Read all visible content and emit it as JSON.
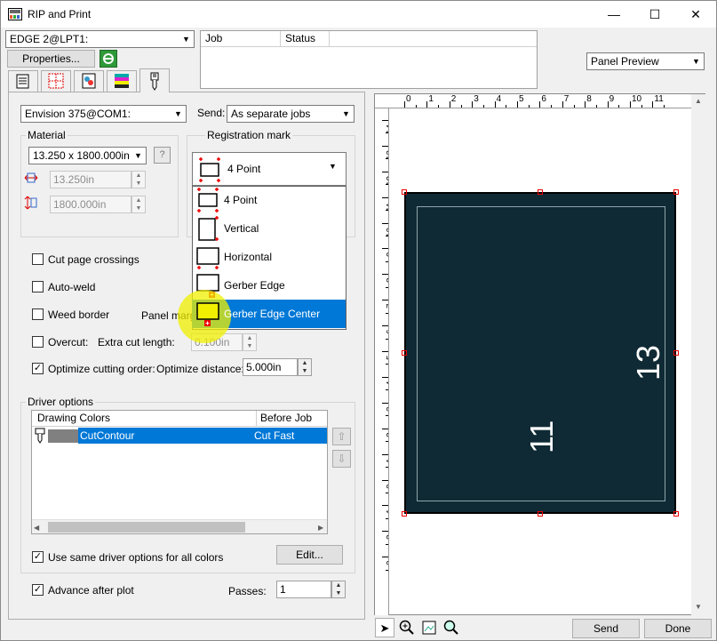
{
  "window": {
    "title": "RIP and Print",
    "minimize": "—",
    "maximize": "☐",
    "close": "✕"
  },
  "top": {
    "printer": "EDGE 2@LPT1:",
    "properties_label": "Properties...",
    "job_columns": [
      "Job",
      "Status"
    ],
    "preview_mode": "Panel Preview"
  },
  "cutter": {
    "device": "Envision 375@COM1:",
    "send_label": "Send:",
    "send_mode": "As separate jobs"
  },
  "material": {
    "title": "Material",
    "size": "13.250 x 1800.000in",
    "width": "13.250in",
    "length": "1800.000in"
  },
  "registration": {
    "title": "Registration mark",
    "selected": "4 Point",
    "options": [
      "4 Point",
      "Vertical",
      "Horizontal",
      "Gerber Edge",
      "Gerber Edge Center"
    ],
    "highlighted_index": 4
  },
  "options": {
    "cut_page_crossings": "Cut page crossings",
    "auto_weld": "Auto-weld",
    "weed_border": "Weed border",
    "panel_margin": "Panel margi",
    "overcut": "Overcut:",
    "extra_cut_length": "Extra cut length:",
    "extra_cut_value": "0.100in",
    "optimize_cutting_order": "Optimize cutting order:",
    "optimize_distance_label": "Optimize distance:",
    "optimize_distance_value": "5.000in"
  },
  "driver": {
    "title": "Driver options",
    "columns": [
      "Drawing Colors",
      "Before Job"
    ],
    "row": {
      "color_name": "CutContour",
      "action": "Cut Fast"
    },
    "same_options": "Use same driver options for all colors",
    "edit_label": "Edit..."
  },
  "bottom": {
    "advance_after_plot": "Advance after plot",
    "passes_label": "Passes:",
    "passes_value": "1",
    "send_label": "Send",
    "done_label": "Done"
  },
  "preview": {
    "ruler_top": [
      "0",
      "1",
      "2",
      "3",
      "4",
      "5",
      "6",
      "7",
      "8",
      "9",
      "10",
      "11"
    ],
    "ruler_left": [
      "15",
      "14",
      "13",
      "12",
      "11",
      "10",
      "9",
      "8",
      "7",
      "6",
      "5",
      "4",
      "3",
      "2",
      "1",
      "0",
      "1",
      "2",
      "3"
    ],
    "panel_width_label": "11",
    "panel_height_label": "13",
    "panel_color": "#0f2a35"
  },
  "colors": {
    "selection": "#0078d7",
    "mark_red": "#e00000",
    "highlight_yellow": "#f0f000"
  }
}
